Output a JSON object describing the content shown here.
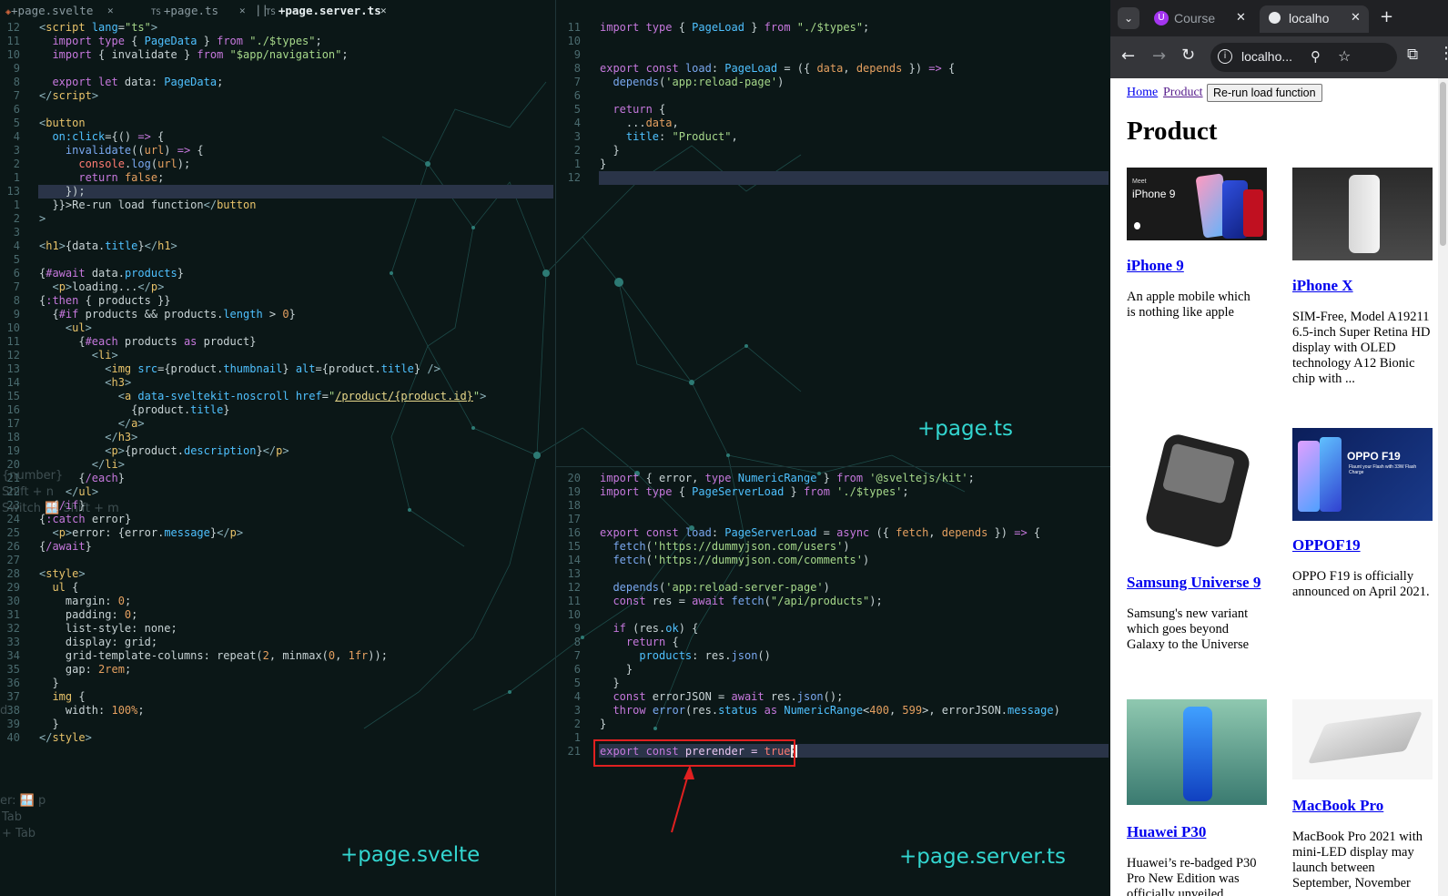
{
  "editor": {
    "tabs": [
      {
        "label": "+page.svelte",
        "active": false
      },
      {
        "label": "+page.ts",
        "active": false
      },
      {
        "label": "+page.server.ts",
        "active": true
      }
    ],
    "pane_labels": {
      "page_ts": "+page.ts",
      "page_svelte": "+page.svelte",
      "page_server_ts": "+page.server.ts"
    },
    "ghost_hints": [
      "{number}",
      "Shift + n",
      "Switch 🪟 Shift + m",
      "er: 🪟 p",
      "Tab",
      "+ Tab",
      "d"
    ],
    "svelte_line_numbers": [
      "12",
      "11",
      "10",
      "9",
      "8",
      "7",
      "6",
      "5",
      "4",
      "3",
      "2",
      "1",
      "13",
      "1",
      "2",
      "3",
      "4",
      "5",
      "6",
      "7",
      "8",
      "9",
      "10",
      "11",
      "12",
      "13",
      "14",
      "15",
      "16",
      "17",
      "18",
      "19",
      "20",
      "21",
      "22",
      "23",
      "24",
      "25",
      "26",
      "27",
      "28",
      "29",
      "30",
      "31",
      "32",
      "33",
      "34",
      "35",
      "36",
      "37",
      "38",
      "39",
      "40"
    ],
    "page_ts_line_numbers": [
      "11",
      "10",
      "9",
      "8",
      "7",
      "6",
      "5",
      "4",
      "3",
      "2",
      "1",
      "12"
    ],
    "server_line_numbers": [
      "20",
      "19",
      "18",
      "17",
      "16",
      "15",
      "14",
      "13",
      "12",
      "11",
      "10",
      "9",
      "8",
      "7",
      "6",
      "5",
      "4",
      "3",
      "2",
      "1",
      "21"
    ],
    "highlight_text": "export const prerender = true;"
  },
  "browser": {
    "tabs": [
      {
        "label": "Course",
        "icon": "udemy-icon"
      },
      {
        "label": "localho",
        "icon": "globe-icon",
        "active": true
      }
    ],
    "address": "localho...",
    "nav_links": [
      "Home",
      "Product"
    ],
    "rerun_button": "Re-run load function",
    "heading": "Product",
    "products": [
      {
        "title": "iPhone 9",
        "description": "An apple mobile which is nothing like apple"
      },
      {
        "title": "iPhone X",
        "description": "SIM-Free, Model A19211 6.5-inch Super Retina HD display with OLED technology A12 Bionic chip with ..."
      },
      {
        "title": "Samsung Universe 9",
        "description": "Samsung's new variant which goes beyond Galaxy to the Universe"
      },
      {
        "title": "OPPOF19",
        "description": "OPPO F19 is officially announced on April 2021."
      },
      {
        "title": "Huawei P30",
        "description": "Huawei’s re-badged P30 Pro New Edition was officially unveiled"
      },
      {
        "title": "MacBook Pro",
        "description": "MacBook Pro 2021 with mini-LED display may launch between September, November"
      }
    ],
    "image_text": {
      "iphone9_meet": "Meet",
      "iphone9_name": "iPhone 9",
      "oppo_name": "OPPO F19",
      "oppo_tag": "Flaunt your Flash with 33W Flash Charge"
    }
  }
}
